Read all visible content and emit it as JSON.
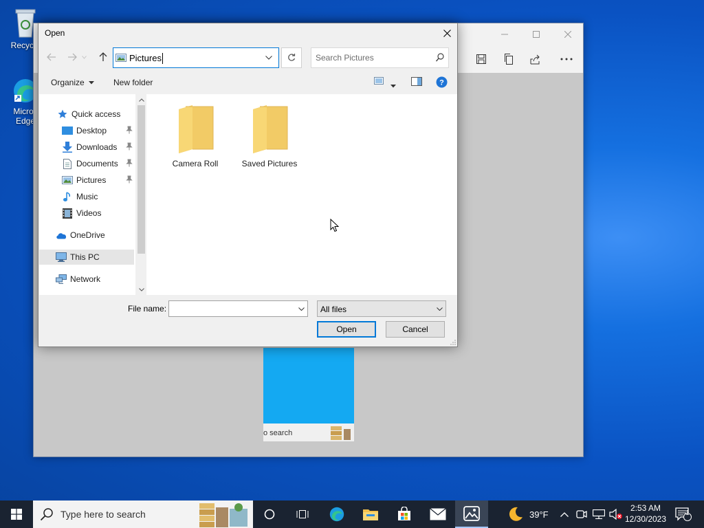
{
  "desktop": {
    "icons": [
      {
        "label": "Recycle",
        "name": "recycle-bin"
      },
      {
        "label": "Micros\nEdge",
        "line1": "Micros",
        "line2": "Edge",
        "name": "microsoft-edge"
      }
    ]
  },
  "bg_app": {
    "thumbnail_search_text": "o search"
  },
  "dialog": {
    "title": "Open",
    "address": "Pictures",
    "search_placeholder": "Search Pictures",
    "commands": {
      "organize": "Organize",
      "new_folder": "New folder"
    },
    "nav": {
      "quick_access": "Quick access",
      "items": [
        {
          "label": "Desktop",
          "pinned": true
        },
        {
          "label": "Downloads",
          "pinned": true
        },
        {
          "label": "Documents",
          "pinned": true
        },
        {
          "label": "Pictures",
          "pinned": true
        },
        {
          "label": "Music",
          "pinned": false
        },
        {
          "label": "Videos",
          "pinned": false
        }
      ],
      "onedrive": "OneDrive",
      "this_pc": "This PC",
      "network": "Network"
    },
    "folders": [
      {
        "label": "Camera Roll"
      },
      {
        "label": "Saved Pictures"
      }
    ],
    "file_name_label": "File name:",
    "file_name_value": "",
    "file_type": "All files",
    "open_button": "Open",
    "cancel_button": "Cancel"
  },
  "taskbar": {
    "search_text": "Type here to search",
    "weather_temp": "39°F",
    "time": "2:53 AM",
    "date": "12/30/2023",
    "notification_count": "1"
  },
  "colors": {
    "accent": "#0078d7",
    "folder": "#f8d775",
    "taskbar": "#1a2331"
  }
}
